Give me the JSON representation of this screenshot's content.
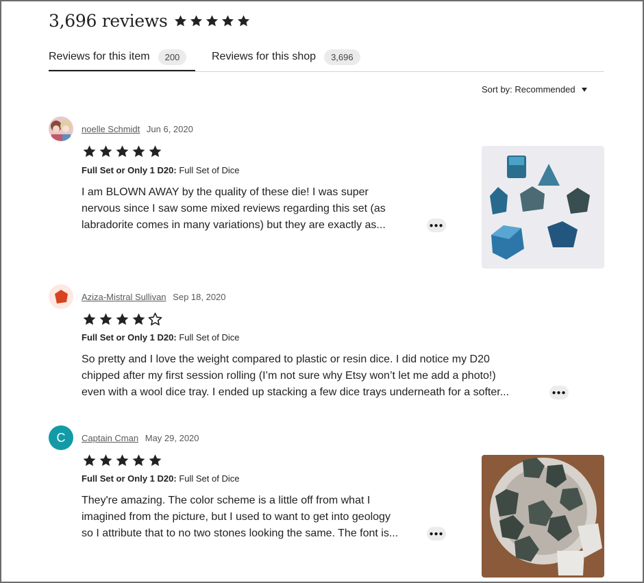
{
  "header": {
    "review_count": "3,696 reviews",
    "rating": 5
  },
  "tabs": [
    {
      "label": "Reviews for this item",
      "count": "200"
    },
    {
      "label": "Reviews for this shop",
      "count": "3,696"
    }
  ],
  "sort": {
    "label": "Sort by:",
    "value": "Recommended"
  },
  "variation_label": "Full Set or Only 1 D20:",
  "reviews": [
    {
      "name": "noelle Schmidt",
      "date": "Jun 6, 2020",
      "rating": 5,
      "variation_value": "Full Set of Dice",
      "lines": [
        "I am BLOWN AWAY by the quality of these die! I was super",
        "nervous since I saw some mixed reviews regarding this set (as",
        "labradorite comes in many variations) but they are exactly as..."
      ]
    },
    {
      "name": "Aziza-Mistral Sullivan",
      "date": "Sep 18, 2020",
      "rating": 4,
      "variation_value": "Full Set of Dice",
      "lines": [
        "So pretty and I love the weight compared to plastic or resin dice. I did notice my D20",
        "chipped after my first session rolling (I’m not sure why Etsy won’t let me add a photo!)",
        "even with a wool dice tray. I ended up stacking a few dice trays underneath for a softer..."
      ]
    },
    {
      "name": "Captain Cman",
      "avatar_letter": "C",
      "date": "May 29, 2020",
      "rating": 5,
      "variation_value": "Full Set of Dice",
      "lines": [
        "They're amazing. The color scheme is a little off from what I",
        "imagined from the picture, but I used to want to get into geology",
        "so I attribute that to no two stones looking the same. The font is..."
      ]
    }
  ],
  "colors": {
    "star": "#222222",
    "avatar_c": "#129ba6",
    "pill_bg": "#ebebeb"
  }
}
